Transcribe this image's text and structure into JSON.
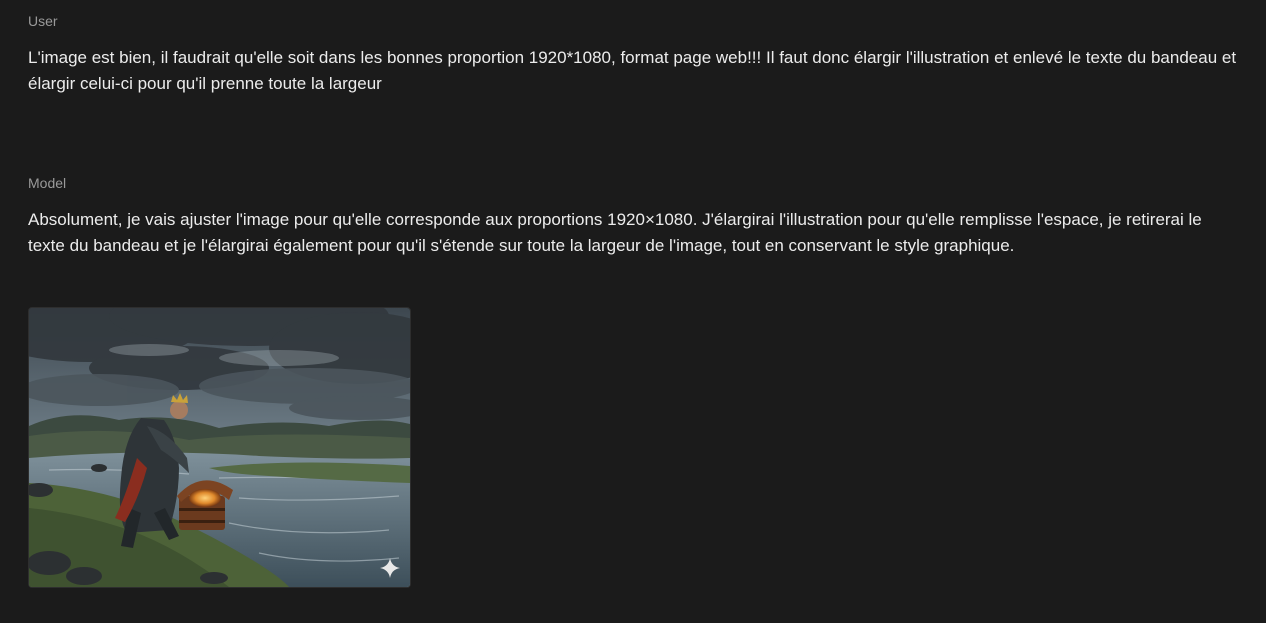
{
  "conversation": {
    "user": {
      "role_label": "User",
      "text": "L'image est bien, il faudrait qu'elle soit dans les bonnes proportion 1920*1080, format page web!!! Il faut donc élargir l'illustration et enlevé le texte du bandeau et élargir celui-ci pour qu'il prenne toute la largeur"
    },
    "model": {
      "role_label": "Model",
      "text": "Absolument, je vais ajuster l'image pour qu'elle corresponde aux proportions 1920×1080. J'élargirai l'illustration pour qu'elle remplisse l'espace, je retirerai le texte du bandeau et je l'élargirai également pour qu'il s'étende sur toute la largeur de l'image, tout en conservant le style graphique.",
      "image": {
        "icon": "sparkle-icon"
      }
    }
  }
}
